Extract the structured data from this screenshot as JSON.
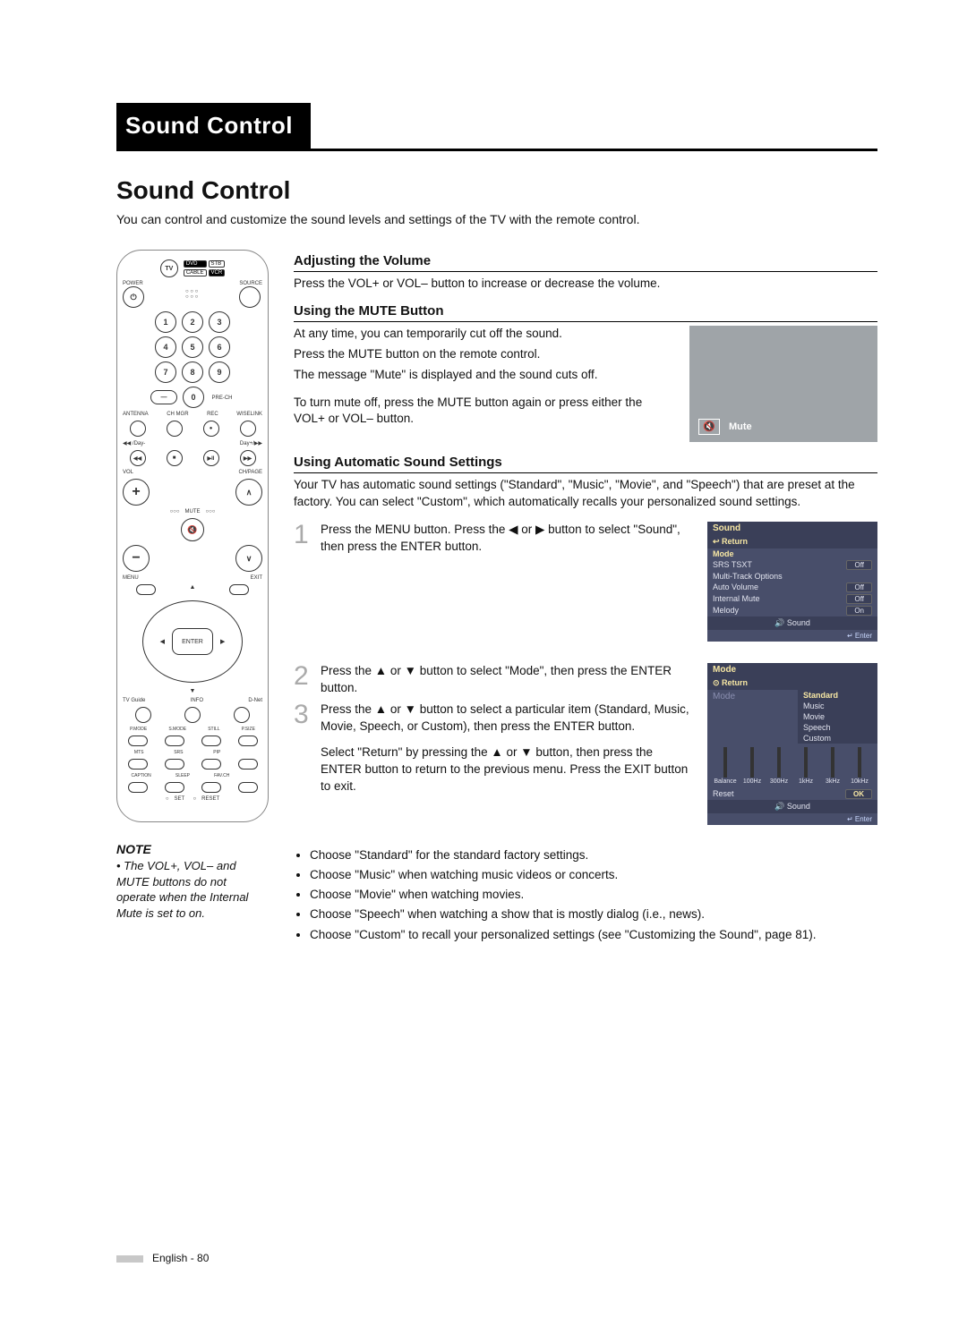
{
  "header_tab": "Sound Control",
  "title": "Sound Control",
  "intro": "You can control and customize the sound levels and settings of the TV with the remote control.",
  "remote": {
    "top": [
      "DVD",
      "STB",
      "CABLE",
      "VCR"
    ],
    "tv": "TV",
    "power": "POWER",
    "source": "SOURCE",
    "digits": [
      "1",
      "2",
      "3",
      "4",
      "5",
      "6",
      "7",
      "8",
      "9",
      "0"
    ],
    "dash": "—",
    "prech": "PRE-CH",
    "antenna": "ANTENNA",
    "chmgr": "CH MGR",
    "rec": "REC",
    "wiselink": "WISELINK",
    "day_minus": "◀◀ /Day-",
    "stop": "■",
    "playpause": "▶II",
    "day_plus": "Day+/▶▶",
    "vol": "VOL",
    "chpage": "CH/PAGE",
    "mute": "MUTE",
    "menu": "MENU",
    "exit": "EXIT",
    "enter": "ENTER",
    "tvguide": "TV Guide",
    "info": "INFO",
    "dnet": "D-Net",
    "row_a": [
      "P.MODE",
      "S.MODE",
      "STILL",
      "P.SIZE"
    ],
    "row_b": [
      "MTS",
      "SRS",
      "PIP",
      "∧"
    ],
    "row_c": [
      "CAPTION",
      "SLEEP",
      "FAV.CH",
      "CH ∨"
    ],
    "set": "SET",
    "reset": "RESET"
  },
  "note": {
    "head": "NOTE",
    "text": "• The VOL+, VOL– and MUTE buttons do not operate when the Internal Mute is set to on."
  },
  "sections": {
    "adjust": {
      "head": "Adjusting the Volume",
      "text": "Press the VOL+ or VOL– button to increase or decrease the volume."
    },
    "mute": {
      "head": "Using the MUTE Button",
      "p1": "At any time, you can temporarily cut off the sound.",
      "p2": "Press the MUTE button on the remote control.",
      "p3": "The message \"Mute\" is displayed and the sound cuts off.",
      "p4": "To turn mute off, press the MUTE button again or press either the VOL+ or VOL– button.",
      "osd_label": "Mute"
    },
    "auto": {
      "head": "Using Automatic Sound Settings",
      "intro": "Your TV has automatic sound settings (\"Standard\", \"Music\", \"Movie\", and \"Speech\") that are preset at the factory. You can select \"Custom\", which automatically recalls your personalized sound settings.",
      "step1": "Press the MENU button. Press the ◀ or ▶ button to select \"Sound\", then press the ENTER button.",
      "step2": "Press the ▲ or ▼ button to select \"Mode\", then press the ENTER button.",
      "step3": "Press the ▲ or ▼ button to select a particular item (Standard, Music, Movie, Speech, or Custom), then press the ENTER button.",
      "step3b": "Select \"Return\" by pressing the ▲ or ▼ button, then press the ENTER button to return to the previous menu. Press the EXIT button to exit.",
      "bullets": [
        "Choose \"Standard\" for the standard factory settings.",
        "Choose \"Music\" when watching music videos or concerts.",
        "Choose \"Movie\" when watching movies.",
        "Choose \"Speech\" when watching a show that is mostly dialog (i.e., news).",
        "Choose \"Custom\" to recall your personalized settings (see \"Customizing the Sound\", page 81)."
      ]
    }
  },
  "osd1": {
    "title": "Sound",
    "return": "↩ Return",
    "rows": [
      {
        "k": "Mode",
        "v": ""
      },
      {
        "k": "SRS TSXT",
        "v": "Off"
      },
      {
        "k": "Multi-Track Options",
        "v": ""
      },
      {
        "k": "Auto Volume",
        "v": "Off"
      },
      {
        "k": "Internal Mute",
        "v": "Off"
      },
      {
        "k": "Melody",
        "v": "On"
      }
    ],
    "foot": "Sound",
    "enter": "↵ Enter"
  },
  "osd2": {
    "title": "Mode",
    "return": "⊙ Return",
    "mode": "Mode",
    "opts": [
      "Standard",
      "Music",
      "Movie",
      "Speech",
      "Custom"
    ],
    "eq": [
      "Balance",
      "100Hz",
      "300Hz",
      "1kHz",
      "3kHz",
      "10kHz"
    ],
    "reset": "Reset",
    "ok": "OK",
    "foot": "Sound",
    "enter": "↵ Enter"
  },
  "footer": "English - 80"
}
